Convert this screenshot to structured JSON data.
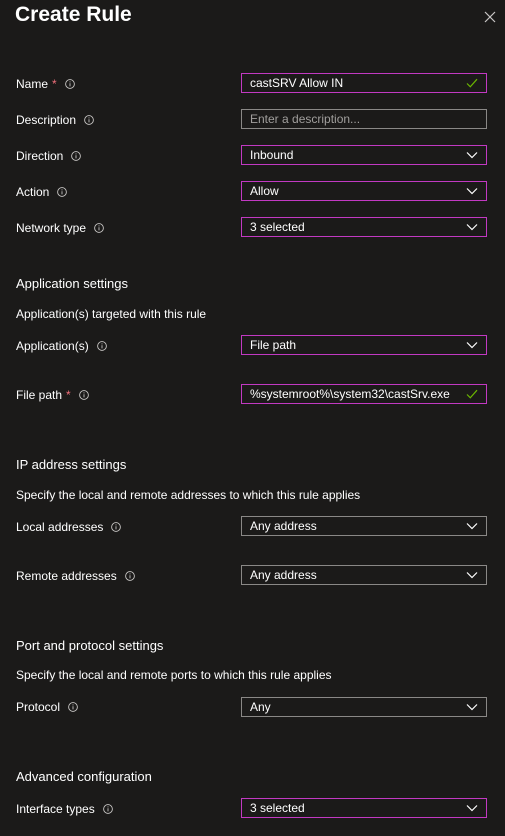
{
  "panel": {
    "title": "Create Rule"
  },
  "fields": {
    "name": {
      "label": "Name",
      "required": "*",
      "value": "castSRV Allow IN"
    },
    "description": {
      "label": "Description",
      "placeholder": "Enter a description..."
    },
    "direction": {
      "label": "Direction",
      "value": "Inbound"
    },
    "action": {
      "label": "Action",
      "value": "Allow"
    },
    "network_type": {
      "label": "Network type",
      "value": "3 selected"
    }
  },
  "application_settings": {
    "heading": "Application settings",
    "description": "Application(s) targeted with this rule",
    "applications": {
      "label": "Application(s)",
      "value": "File path"
    },
    "file_path": {
      "label": "File path",
      "required": "*",
      "value": "%systemroot%\\system32\\castSrv.exe"
    }
  },
  "ip_settings": {
    "heading": "IP address settings",
    "description": "Specify the local and remote addresses to which this rule applies",
    "local": {
      "label": "Local addresses",
      "value": "Any address"
    },
    "remote": {
      "label": "Remote addresses",
      "value": "Any address"
    }
  },
  "port_settings": {
    "heading": "Port and protocol settings",
    "description": "Specify the local and remote ports to which this rule applies",
    "protocol": {
      "label": "Protocol",
      "value": "Any"
    }
  },
  "advanced": {
    "heading": "Advanced configuration",
    "interface_types": {
      "label": "Interface types",
      "value": "3 selected"
    }
  },
  "icons": {
    "close": "close-icon",
    "info": "info-icon",
    "dropdown": "chevron-down-icon",
    "valid": "checkmark-icon"
  },
  "colors": {
    "background": "#1b1a19",
    "focus_border": "#c239c2",
    "default_border": "#8a8886",
    "required": "#f1707b",
    "valid_check": "#6bb700"
  }
}
